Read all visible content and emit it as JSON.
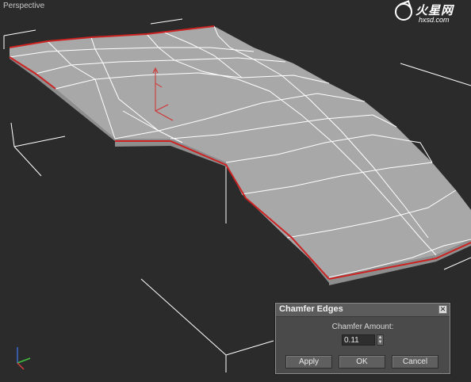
{
  "viewport": {
    "label": "Perspective"
  },
  "watermark": {
    "brand": "火星网",
    "site": "hxsd.com"
  },
  "dialog": {
    "title": "Chamfer Edges",
    "close_glyph": "✕",
    "amount_label": "Chamfer Amount:",
    "amount_value": "0.11",
    "buttons": {
      "apply": "Apply",
      "ok": "OK",
      "cancel": "Cancel"
    }
  },
  "colors": {
    "viewport_bg": "#2b2b2b",
    "mesh_face": "#a6a6a6",
    "mesh_edge": "#ffffff",
    "selected_edge": "#cc2222",
    "gizmo": "#d23030"
  },
  "icons": {
    "gizmo": "transform-gizmo-icon",
    "axis": "axis-tripod-icon"
  }
}
